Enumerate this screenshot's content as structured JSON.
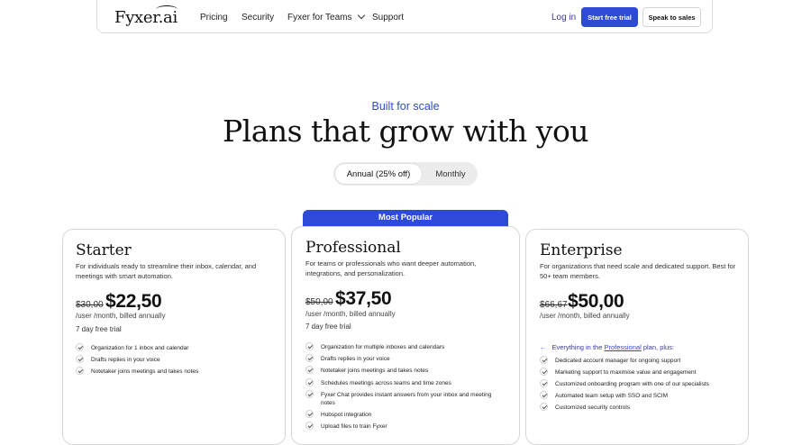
{
  "nav": {
    "logo": "Fyxer.ai",
    "links": [
      "Pricing",
      "Security",
      "Fyxer for Teams",
      "Support"
    ],
    "login": "Log in",
    "trial_button": "Start free trial",
    "sales_button": "Speak to sales"
  },
  "hero": {
    "eyebrow": "Built for scale",
    "headline": "Plans that grow with you"
  },
  "billing_toggle": {
    "annual": "Annual (25% off)",
    "monthly": "Monthly",
    "selected": "annual"
  },
  "plans": [
    {
      "name": "Starter",
      "desc": "For individuals ready to streamline their inbox, calendar, and meetings with smart automation.",
      "old_price": "$30,00",
      "price": "$22,50",
      "per": "/user /month, billed annually",
      "trial": "7 day free trial",
      "features": [
        "Organization for 1 inbox and calendar",
        "Drafts replies in your voice",
        "Notetaker joins meetings and takes notes"
      ]
    },
    {
      "badge": "Most Popular",
      "name": "Professional",
      "desc": "For teams or professionals who want deeper automation, integrations, and personalization.",
      "old_price": "$50,00",
      "price": "$37,50",
      "per": "/user /month, billed annually",
      "trial": "7 day free trial",
      "features": [
        "Organization for multiple inboxes and calendars",
        "Drafts replies in your voice",
        "Notetaker joins meetings and takes notes",
        "Schedules meetings across teams and time zones",
        "Fyxer Chat provides instant answers from your inbox and meeting notes",
        "Hubspot integration",
        "Upload files to train Fyxer"
      ]
    },
    {
      "name": "Enterprise",
      "desc": "For organizations that need scale and dedicated support. Best for 50+ team members.",
      "old_price": "$66,67",
      "price": "$50,00",
      "per": "/user /month, billed annually",
      "everything_prefix": "Everything in the",
      "everything_link": "Professional",
      "everything_suffix": "plan, plus:",
      "features": [
        "Dedicated account manager for ongoing support",
        "Marketing support to maximise value and engagement",
        "Customized onboarding program with one of our specialists",
        "Automated team setup with SSO and SCIM",
        "Customized security controls"
      ]
    }
  ],
  "colors": {
    "accent": "#2d4bd6",
    "border": "#d6d6d6"
  }
}
